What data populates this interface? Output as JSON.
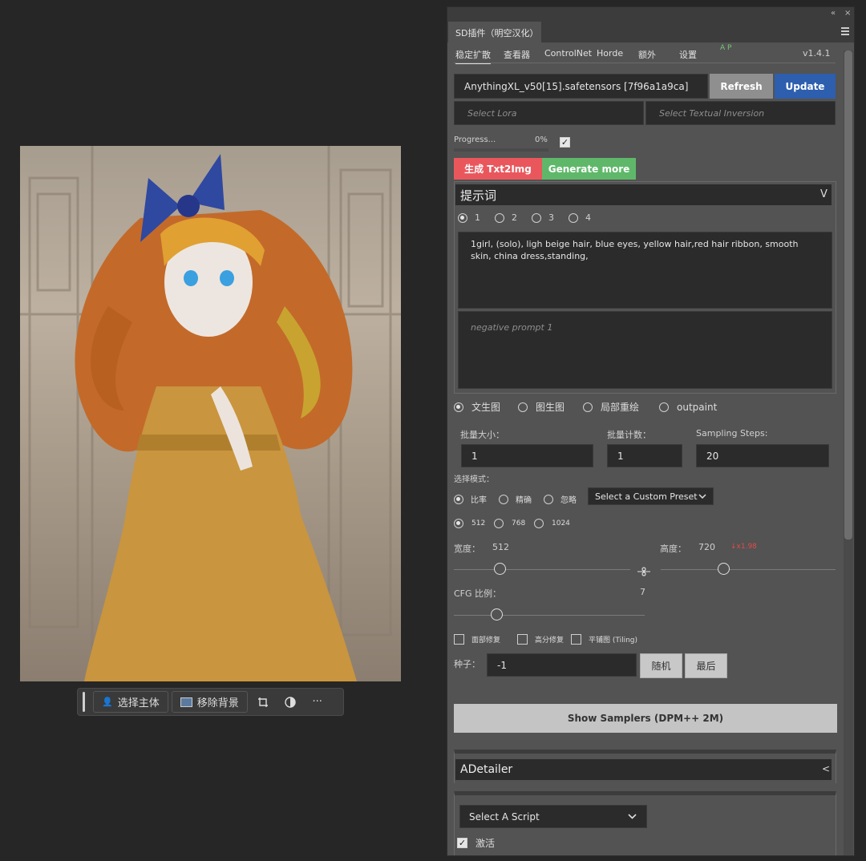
{
  "canvas": {
    "toolbar": {
      "select_subject": "选择主体",
      "remove_bg": "移除背景",
      "more": "···"
    }
  },
  "panel": {
    "title": "SD插件（明空汉化）",
    "window_controls": [
      "«",
      "×"
    ],
    "subtabs": [
      "稳定扩散",
      "查看器",
      "ControlNet",
      "Horde",
      "额外",
      "设置"
    ],
    "ap_label": "A P",
    "version": "v1.4.1",
    "model": "AnythingXL_v50[15].safetensors [7f96a1a9ca]",
    "refresh_label": "Refresh",
    "update_label": "Update",
    "lora_placeholder": "Select Lora",
    "ti_placeholder": "Select Textual Inversion",
    "progress_label": "Progress...",
    "progress_value": "0%",
    "progress_fraction": 0,
    "generate_label": "生成 Txt2Img",
    "generate_more_label": "Generate more",
    "prompt_header": "提示词",
    "prompt_chevron": "V",
    "prompt_slots": [
      "1",
      "2",
      "3",
      "4"
    ],
    "prompt_text": "1girl, (solo), ligh beige hair, blue eyes, yellow hair,red hair ribbon, smooth skin, china dress,standing,",
    "negative_placeholder": "negative prompt 1",
    "modes": [
      "文生图",
      "图生图",
      "局部重绘",
      "outpaint"
    ],
    "batch_size_label": "批量大小：",
    "batch_size": "1",
    "batch_count_label": "批量计数：",
    "batch_count": "1",
    "steps_label": "Sampling Steps:",
    "steps": "20",
    "select_mode_label": "选择模式：",
    "ratio_modes": [
      "比率",
      "精确",
      "忽略"
    ],
    "preset_label": "Select a Custom Preset",
    "sizes": [
      "512",
      "768",
      "1024"
    ],
    "width_label": "宽度：",
    "width": "512",
    "height_label": "高度：",
    "height": "720",
    "ratio_note": "↓x1.98",
    "cfg_label": "CFG 比例：",
    "cfg": "7",
    "options": [
      "面部修复",
      "高分修复",
      "平铺图 (Tiling)"
    ],
    "seed_label": "种子：",
    "seed": "-1",
    "random_label": "随机",
    "last_label": "最后",
    "samplers_label": "Show Samplers (DPM++ 2M)",
    "adetailer_label": "ADetailer",
    "adetailer_chevron": "<",
    "script_label": "Select A Script",
    "activate_label": "激活"
  },
  "colors": {
    "generate": "#e9575d",
    "generate_more": "#5fb86a",
    "update": "#2e5eae",
    "ratio_note": "#e24a4a"
  }
}
